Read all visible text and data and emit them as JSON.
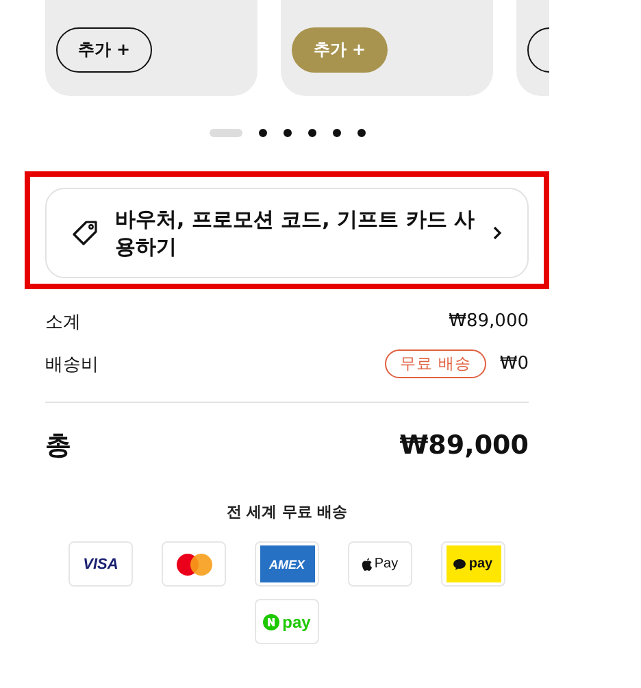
{
  "product_cards": [
    {
      "button": {
        "label": "추가 +",
        "kind": "outline"
      }
    },
    {
      "button": {
        "label": "추가 +",
        "kind": "filled"
      }
    },
    {
      "button": {
        "kind": "outline"
      }
    }
  ],
  "carousel_dots": [
    {
      "selected": true
    },
    {
      "selected": false
    },
    {
      "selected": false
    },
    {
      "selected": false
    },
    {
      "selected": false
    },
    {
      "selected": false
    }
  ],
  "voucher": {
    "label": "바우처, 프로모션 코드, 기프트 카드 사용하기",
    "highlighted": true
  },
  "summary": [
    {
      "label": "소계",
      "value": "₩89,000"
    },
    {
      "label": "배송비",
      "badge": "무료 배송",
      "value": "₩0"
    }
  ],
  "total": {
    "label": "총",
    "value": "₩89,000"
  },
  "shipping_note": "전 세계 무료 배송",
  "payment_methods": [
    {
      "kind": "visa",
      "text": "VISA"
    },
    {
      "kind": "mastercard"
    },
    {
      "kind": "amex",
      "text": "AMEX"
    },
    {
      "kind": "applepay",
      "text": "Pay"
    },
    {
      "kind": "kakaopay",
      "text": "pay"
    },
    {
      "kind": "npay",
      "text": "pay"
    }
  ]
}
